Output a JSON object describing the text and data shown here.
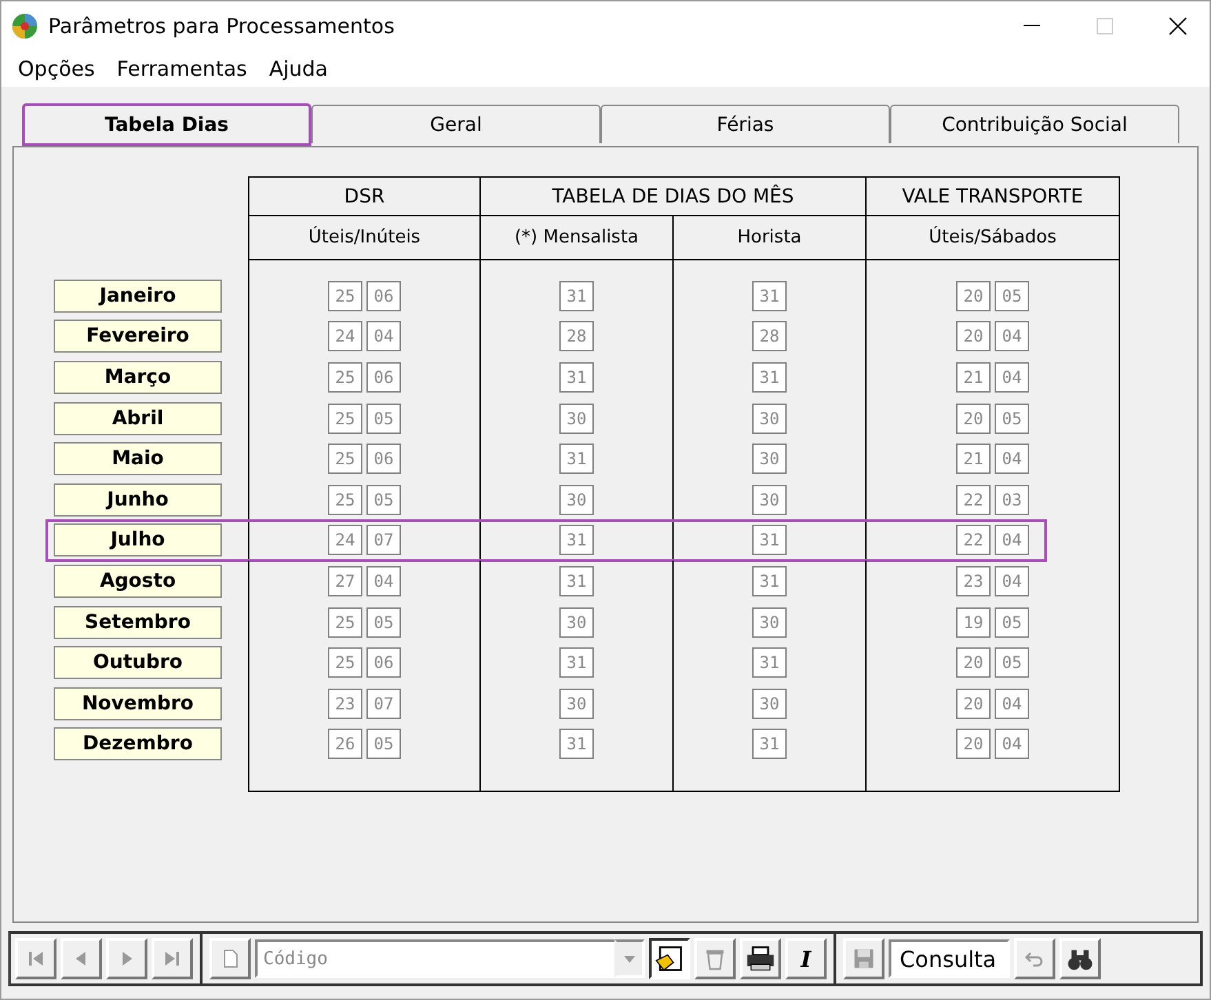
{
  "window": {
    "title": "Parâmetros para Processamentos"
  },
  "menu": [
    "Opções",
    "Ferramentas",
    "Ajuda"
  ],
  "tabs": [
    {
      "label": "Tabela Dias",
      "selected": true
    },
    {
      "label": "Geral",
      "selected": false
    },
    {
      "label": "Férias",
      "selected": false
    },
    {
      "label": "Contribuição Social",
      "selected": false
    }
  ],
  "table": {
    "group_headers": [
      "DSR",
      "TABELA DE DIAS DO MÊS",
      "VALE TRANSPORTE"
    ],
    "sub_headers": [
      "Úteis/Inúteis",
      "(*) Mensalista",
      "Horista",
      "Úteis/Sábados"
    ],
    "rows": [
      {
        "month": "Janeiro",
        "dsr": [
          "25",
          "06"
        ],
        "mensalista": "31",
        "horista": "31",
        "vale": [
          "20",
          "05"
        ],
        "selected": false
      },
      {
        "month": "Fevereiro",
        "dsr": [
          "24",
          "04"
        ],
        "mensalista": "28",
        "horista": "28",
        "vale": [
          "20",
          "04"
        ],
        "selected": false
      },
      {
        "month": "Março",
        "dsr": [
          "25",
          "06"
        ],
        "mensalista": "31",
        "horista": "31",
        "vale": [
          "21",
          "04"
        ],
        "selected": false
      },
      {
        "month": "Abril",
        "dsr": [
          "25",
          "05"
        ],
        "mensalista": "30",
        "horista": "30",
        "vale": [
          "20",
          "05"
        ],
        "selected": false
      },
      {
        "month": "Maio",
        "dsr": [
          "25",
          "06"
        ],
        "mensalista": "31",
        "horista": "30",
        "vale": [
          "21",
          "04"
        ],
        "selected": false
      },
      {
        "month": "Junho",
        "dsr": [
          "25",
          "05"
        ],
        "mensalista": "30",
        "horista": "30",
        "vale": [
          "22",
          "03"
        ],
        "selected": false
      },
      {
        "month": "Julho",
        "dsr": [
          "24",
          "07"
        ],
        "mensalista": "31",
        "horista": "31",
        "vale": [
          "22",
          "04"
        ],
        "selected": true
      },
      {
        "month": "Agosto",
        "dsr": [
          "27",
          "04"
        ],
        "mensalista": "31",
        "horista": "31",
        "vale": [
          "23",
          "04"
        ],
        "selected": false
      },
      {
        "month": "Setembro",
        "dsr": [
          "25",
          "05"
        ],
        "mensalista": "30",
        "horista": "30",
        "vale": [
          "19",
          "05"
        ],
        "selected": false
      },
      {
        "month": "Outubro",
        "dsr": [
          "25",
          "06"
        ],
        "mensalista": "31",
        "horista": "31",
        "vale": [
          "20",
          "05"
        ],
        "selected": false
      },
      {
        "month": "Novembro",
        "dsr": [
          "23",
          "07"
        ],
        "mensalista": "30",
        "horista": "30",
        "vale": [
          "20",
          "04"
        ],
        "selected": false
      },
      {
        "month": "Dezembro",
        "dsr": [
          "26",
          "05"
        ],
        "mensalista": "31",
        "horista": "31",
        "vale": [
          "20",
          "04"
        ],
        "selected": false
      }
    ]
  },
  "toolbar": [
    {
      "kind": "first",
      "disabled": true
    },
    {
      "kind": "prev",
      "disabled": true
    },
    {
      "kind": "next",
      "disabled": true
    },
    {
      "kind": "last",
      "disabled": true
    },
    {
      "kind": "separator"
    },
    {
      "kind": "new",
      "disabled": true
    },
    {
      "kind": "combo",
      "placeholder": "Código"
    },
    {
      "kind": "edit",
      "disabled": false,
      "pressed": true
    },
    {
      "kind": "delete",
      "disabled": true
    },
    {
      "kind": "print",
      "disabled": false
    },
    {
      "kind": "text",
      "label": "I",
      "disabled": false
    },
    {
      "kind": "separator"
    },
    {
      "kind": "save",
      "disabled": true
    },
    {
      "kind": "status",
      "value": "Consulta"
    },
    {
      "kind": "undo",
      "disabled": true
    },
    {
      "kind": "find",
      "disabled": false
    }
  ]
}
